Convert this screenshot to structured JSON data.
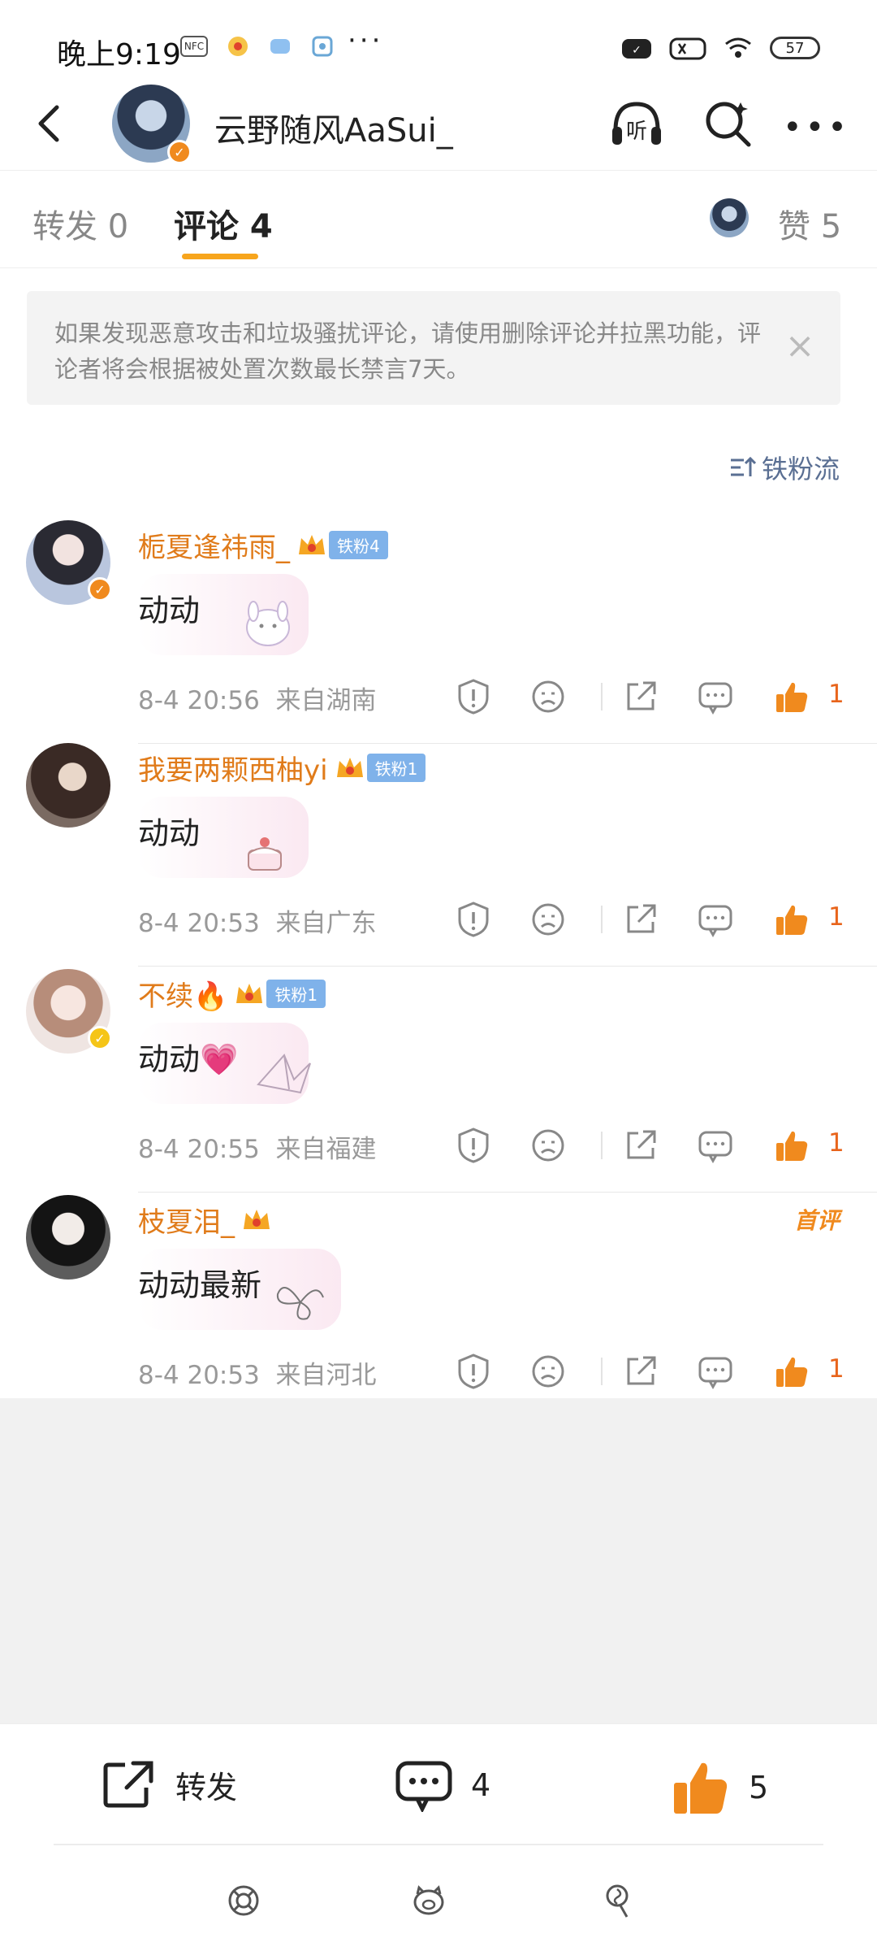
{
  "status_bar": {
    "time": "晚上9:19",
    "left_icons": [
      "NFC",
      "weibo-app-icon",
      "cloud-app-icon",
      "map-app-icon"
    ],
    "more": "···",
    "battery": "57"
  },
  "header": {
    "title": "云野随风AaSui_",
    "listen_label": "听"
  },
  "tabs": {
    "repost": "转发 0",
    "comment": "评论 4",
    "like": "赞 5"
  },
  "notice": {
    "text": "如果发现恶意攻击和垃圾骚扰评论，请使用删除评论并拉黑功能，评论者将会根据被处置次数最长禁言7天。",
    "close": "×"
  },
  "sort": {
    "label": "铁粉流"
  },
  "comments": [
    {
      "name": "栀夏逢祎雨_",
      "fan_badge": "铁粉4",
      "text": "动动",
      "time": "8-4 20:56",
      "location": "来自湖南",
      "likes": "1",
      "verified": true,
      "verified_color": "orange"
    },
    {
      "name": "我要两颗西柚yi",
      "fan_badge": "铁粉1",
      "text": "动动",
      "time": "8-4 20:53",
      "location": "来自广东",
      "likes": "1",
      "verified": false
    },
    {
      "name": "不续🔥",
      "fan_badge": "铁粉1",
      "text": "动动💗",
      "time": "8-4 20:55",
      "location": "来自福建",
      "likes": "1",
      "verified": true,
      "verified_color": "yellow"
    },
    {
      "name": "枝夏泪_",
      "fan_badge": "",
      "text": "动动最新",
      "time": "8-4 20:53",
      "location": "来自河北",
      "likes": "1",
      "verified": false,
      "first_badge": "首评"
    }
  ],
  "bottom_bar": {
    "repost_label": "转发",
    "comment_count": "4",
    "like_count": "5"
  },
  "colors": {
    "accent_orange": "#e07b1a",
    "tab_underline": "#f7a51d",
    "fan_badge": "#7fb2ea",
    "like_orange": "#e8641b"
  }
}
